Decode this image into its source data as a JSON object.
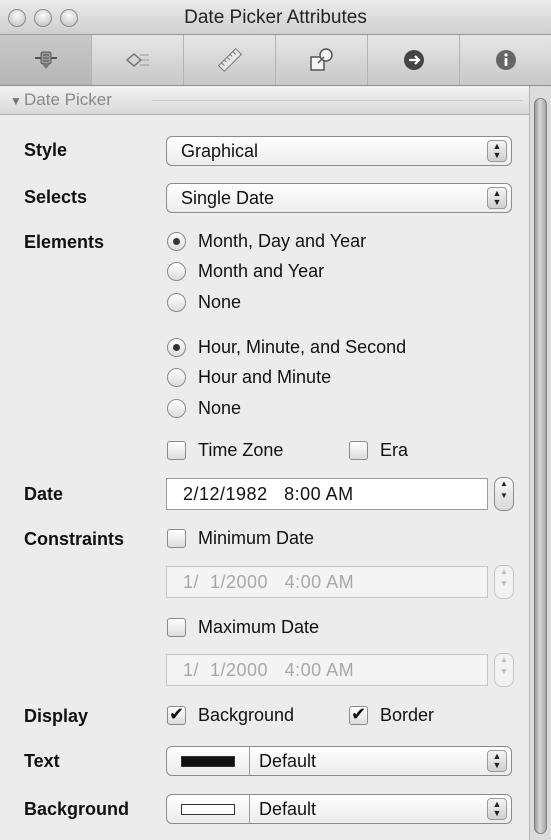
{
  "window": {
    "title": "Date Picker Attributes"
  },
  "toolbar": {
    "tabs": [
      {
        "icon": "attributes-slider-icon",
        "active": true
      },
      {
        "icon": "effects-icon",
        "active": false
      },
      {
        "icon": "size-ruler-icon",
        "active": false
      },
      {
        "icon": "bindings-icon",
        "active": false
      },
      {
        "icon": "connections-arrow-icon",
        "active": false
      },
      {
        "icon": "info-icon",
        "active": false
      }
    ]
  },
  "section": {
    "title": "Date Picker"
  },
  "style": {
    "label": "Style",
    "value": "Graphical"
  },
  "selects": {
    "label": "Selects",
    "value": "Single Date"
  },
  "elements": {
    "label": "Elements",
    "date_options": [
      {
        "label": "Month, Day and Year",
        "selected": true
      },
      {
        "label": "Month and Year",
        "selected": false
      },
      {
        "label": "None",
        "selected": false
      }
    ],
    "time_options": [
      {
        "label": "Hour, Minute, and Second",
        "selected": true
      },
      {
        "label": "Hour and Minute",
        "selected": false
      },
      {
        "label": "None",
        "selected": false
      }
    ],
    "time_zone": {
      "label": "Time Zone",
      "checked": false
    },
    "era": {
      "label": "Era",
      "checked": false
    }
  },
  "date": {
    "label": "Date",
    "value": "2/12/1982   8:00 AM"
  },
  "constraints": {
    "label": "Constraints",
    "minimum": {
      "label": "Minimum Date",
      "checked": false,
      "value": "1/  1/2000   4:00 AM"
    },
    "maximum": {
      "label": "Maximum Date",
      "checked": false,
      "value": "1/  1/2000   4:00 AM"
    }
  },
  "display": {
    "label": "Display",
    "background": {
      "label": "Background",
      "checked": true
    },
    "border": {
      "label": "Border",
      "checked": true
    }
  },
  "text_color": {
    "label": "Text",
    "value": "Default",
    "swatch": "#111111"
  },
  "background_color": {
    "label": "Background",
    "value": "Default",
    "swatch": "#ffffff"
  }
}
